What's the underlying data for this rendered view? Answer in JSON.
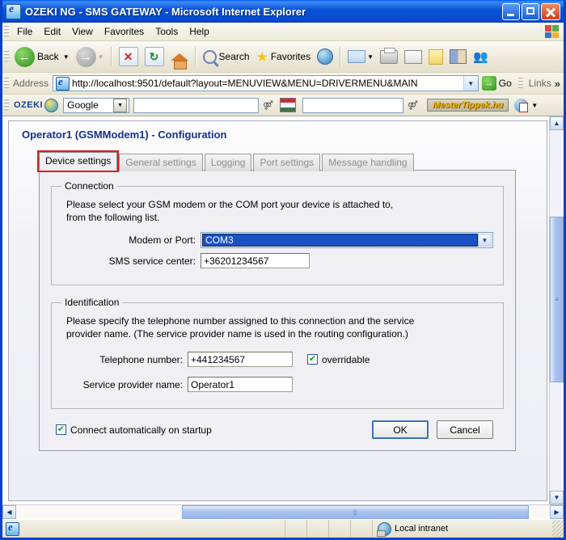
{
  "window": {
    "title": "OZEKI NG - SMS GATEWAY - Microsoft Internet Explorer",
    "minimize_label": "Minimize",
    "maximize_label": "Maximize",
    "close_label": "Close"
  },
  "menubar": {
    "items": [
      "File",
      "Edit",
      "View",
      "Favorites",
      "Tools",
      "Help"
    ]
  },
  "toolbar": {
    "back_label": "Back",
    "forward_label": "",
    "stop_label": "",
    "refresh_label": "",
    "home_label": "",
    "search_label": "Search",
    "favorites_label": "Favorites",
    "media_label": "",
    "mail_label": "",
    "print_label": "",
    "edit_label": "",
    "notes_label": "",
    "research_label": "",
    "messenger_label": ""
  },
  "address": {
    "label": "Address",
    "url": "http://localhost:9501/default?layout=MENUVIEW&MENU=DRIVERMENU&MAIN",
    "go_label": "Go",
    "go_glyph": "→",
    "links_label": "Links",
    "chevron": "»"
  },
  "ozeki_toolbar": {
    "brand": "OZEKI",
    "search_engine": "Google",
    "search_value": "",
    "search_value2": "",
    "partner_logo": "MesterTippek.hu"
  },
  "page": {
    "title": "Operator1 (GSMModem1) - Configuration",
    "tabs": [
      {
        "label": "Device settings",
        "active": true,
        "highlighted": true
      },
      {
        "label": "General settings",
        "active": false,
        "highlighted": false
      },
      {
        "label": "Logging",
        "active": false,
        "highlighted": false
      },
      {
        "label": "Port settings",
        "active": false,
        "highlighted": false
      },
      {
        "label": "Message handling",
        "active": false,
        "highlighted": false
      }
    ],
    "connection": {
      "legend": "Connection",
      "description_line1": "Please select your GSM modem or the COM port your device is attached to,",
      "description_line2": "from the following list.",
      "modem_label": "Modem or Port:",
      "modem_value": "COM3",
      "smsc_label": "SMS service center:",
      "smsc_value": "+36201234567"
    },
    "identification": {
      "legend": "Identification",
      "description_line1": "Please specify the telephone number assigned to this connection and the service",
      "description_line2": "provider name. (The service provider name is used in the routing configuration.)",
      "phone_label": "Telephone number:",
      "phone_value": "+441234567",
      "overridable_label": "overridable",
      "provider_label": "Service provider name:",
      "provider_value": "Operator1"
    },
    "footer": {
      "autoconnect_label": "Connect automatically on startup",
      "ok_label": "OK",
      "cancel_label": "Cancel"
    }
  },
  "statusbar": {
    "zone": "Local intranet"
  },
  "colors": {
    "titlebar_blue": "#0a52d8",
    "heading_blue": "#12318c",
    "select_highlight": "#1a51c4",
    "highlight_red": "#e01b1b",
    "check_green": "#1a9a23"
  }
}
